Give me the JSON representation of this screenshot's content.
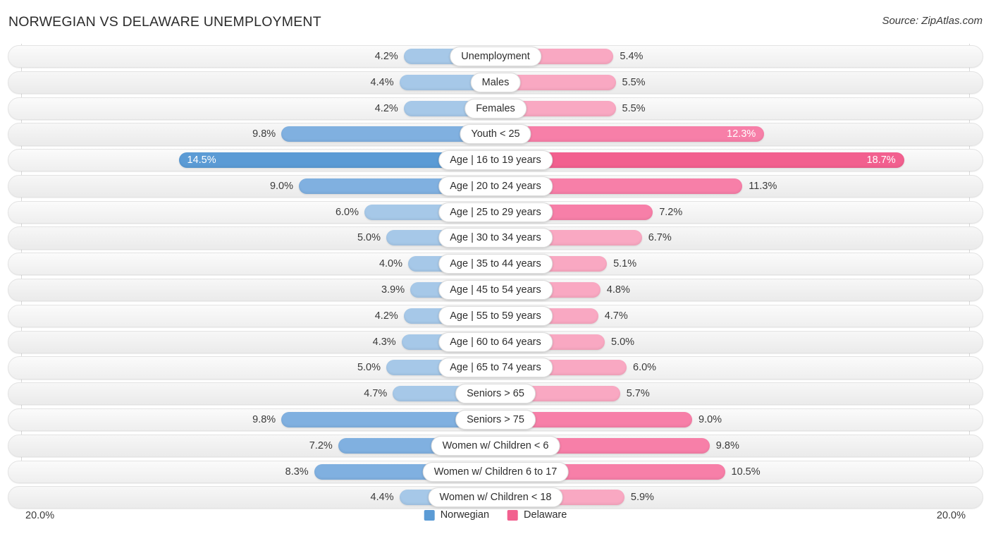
{
  "header": {
    "title": "NORWEGIAN VS DELAWARE UNEMPLOYMENT",
    "source": "Source: ZipAtlas.com"
  },
  "footer": {
    "axis_min_label": "20.0%",
    "axis_max_label": "20.0%",
    "legend": [
      {
        "name": "Norwegian",
        "color": "#5b9bd5"
      },
      {
        "name": "Delaware",
        "color": "#f2608f"
      }
    ]
  },
  "colors": {
    "left_light": "#a6c8e8",
    "left_mid": "#80b0e0",
    "left_dark": "#5b9bd5",
    "right_light": "#f9a8c2",
    "right_mid": "#f77fa8",
    "right_dark": "#f2608f",
    "track": "#f2f2f2",
    "gridline": "#d8d8d8"
  },
  "chart_data": {
    "type": "bar",
    "orientation": "horizontal-diverging",
    "title": "NORWEGIAN VS DELAWARE UNEMPLOYMENT",
    "xlabel": "",
    "ylabel": "",
    "axis_max": 20.0,
    "unit": "%",
    "grid": true,
    "legend_position": "bottom-center",
    "categories": [
      "Unemployment",
      "Males",
      "Females",
      "Youth < 25",
      "Age | 16 to 19 years",
      "Age | 20 to 24 years",
      "Age | 25 to 29 years",
      "Age | 30 to 34 years",
      "Age | 35 to 44 years",
      "Age | 45 to 54 years",
      "Age | 55 to 59 years",
      "Age | 60 to 64 years",
      "Age | 65 to 74 years",
      "Seniors > 65",
      "Seniors > 75",
      "Women w/ Children < 6",
      "Women w/ Children 6 to 17",
      "Women w/ Children < 18"
    ],
    "series": [
      {
        "name": "Norwegian",
        "values": [
          4.2,
          4.4,
          4.2,
          9.8,
          14.5,
          9.0,
          6.0,
          5.0,
          4.0,
          3.9,
          4.2,
          4.3,
          5.0,
          4.7,
          9.8,
          7.2,
          8.3,
          4.4
        ]
      },
      {
        "name": "Delaware",
        "values": [
          5.4,
          5.5,
          5.5,
          12.3,
          18.7,
          11.3,
          7.2,
          6.7,
          5.1,
          4.8,
          4.7,
          5.0,
          6.0,
          5.7,
          9.0,
          9.8,
          10.5,
          5.9
        ]
      }
    ]
  },
  "rows": [
    {
      "label": "Unemployment",
      "left_value": 4.2,
      "left_text": "4.2%",
      "right_value": 5.4,
      "right_text": "5.4%",
      "left_shade": "light",
      "right_shade": "light",
      "left_inside": false,
      "right_inside": false
    },
    {
      "label": "Males",
      "left_value": 4.4,
      "left_text": "4.4%",
      "right_value": 5.5,
      "right_text": "5.5%",
      "left_shade": "light",
      "right_shade": "light",
      "left_inside": false,
      "right_inside": false
    },
    {
      "label": "Females",
      "left_value": 4.2,
      "left_text": "4.2%",
      "right_value": 5.5,
      "right_text": "5.5%",
      "left_shade": "light",
      "right_shade": "light",
      "left_inside": false,
      "right_inside": false
    },
    {
      "label": "Youth < 25",
      "left_value": 9.8,
      "left_text": "9.8%",
      "right_value": 12.3,
      "right_text": "12.3%",
      "left_shade": "mid",
      "right_shade": "mid",
      "left_inside": false,
      "right_inside": true
    },
    {
      "label": "Age | 16 to 19 years",
      "left_value": 14.5,
      "left_text": "14.5%",
      "right_value": 18.7,
      "right_text": "18.7%",
      "left_shade": "dark",
      "right_shade": "dark",
      "left_inside": true,
      "right_inside": true
    },
    {
      "label": "Age | 20 to 24 years",
      "left_value": 9.0,
      "left_text": "9.0%",
      "right_value": 11.3,
      "right_text": "11.3%",
      "left_shade": "mid",
      "right_shade": "mid",
      "left_inside": false,
      "right_inside": false
    },
    {
      "label": "Age | 25 to 29 years",
      "left_value": 6.0,
      "left_text": "6.0%",
      "right_value": 7.2,
      "right_text": "7.2%",
      "left_shade": "light",
      "right_shade": "mid",
      "left_inside": false,
      "right_inside": false
    },
    {
      "label": "Age | 30 to 34 years",
      "left_value": 5.0,
      "left_text": "5.0%",
      "right_value": 6.7,
      "right_text": "6.7%",
      "left_shade": "light",
      "right_shade": "light",
      "left_inside": false,
      "right_inside": false
    },
    {
      "label": "Age | 35 to 44 years",
      "left_value": 4.0,
      "left_text": "4.0%",
      "right_value": 5.1,
      "right_text": "5.1%",
      "left_shade": "light",
      "right_shade": "light",
      "left_inside": false,
      "right_inside": false
    },
    {
      "label": "Age | 45 to 54 years",
      "left_value": 3.9,
      "left_text": "3.9%",
      "right_value": 4.8,
      "right_text": "4.8%",
      "left_shade": "light",
      "right_shade": "light",
      "left_inside": false,
      "right_inside": false
    },
    {
      "label": "Age | 55 to 59 years",
      "left_value": 4.2,
      "left_text": "4.2%",
      "right_value": 4.7,
      "right_text": "4.7%",
      "left_shade": "light",
      "right_shade": "light",
      "left_inside": false,
      "right_inside": false
    },
    {
      "label": "Age | 60 to 64 years",
      "left_value": 4.3,
      "left_text": "4.3%",
      "right_value": 5.0,
      "right_text": "5.0%",
      "left_shade": "light",
      "right_shade": "light",
      "left_inside": false,
      "right_inside": false
    },
    {
      "label": "Age | 65 to 74 years",
      "left_value": 5.0,
      "left_text": "5.0%",
      "right_value": 6.0,
      "right_text": "6.0%",
      "left_shade": "light",
      "right_shade": "light",
      "left_inside": false,
      "right_inside": false
    },
    {
      "label": "Seniors > 65",
      "left_value": 4.7,
      "left_text": "4.7%",
      "right_value": 5.7,
      "right_text": "5.7%",
      "left_shade": "light",
      "right_shade": "light",
      "left_inside": false,
      "right_inside": false
    },
    {
      "label": "Seniors > 75",
      "left_value": 9.8,
      "left_text": "9.8%",
      "right_value": 9.0,
      "right_text": "9.0%",
      "left_shade": "mid",
      "right_shade": "mid",
      "left_inside": false,
      "right_inside": false
    },
    {
      "label": "Women w/ Children < 6",
      "left_value": 7.2,
      "left_text": "7.2%",
      "right_value": 9.8,
      "right_text": "9.8%",
      "left_shade": "mid",
      "right_shade": "mid",
      "left_inside": false,
      "right_inside": false
    },
    {
      "label": "Women w/ Children 6 to 17",
      "left_value": 8.3,
      "left_text": "8.3%",
      "right_value": 10.5,
      "right_text": "10.5%",
      "left_shade": "mid",
      "right_shade": "mid",
      "left_inside": false,
      "right_inside": false
    },
    {
      "label": "Women w/ Children < 18",
      "left_value": 4.4,
      "left_text": "4.4%",
      "right_value": 5.9,
      "right_text": "5.9%",
      "left_shade": "light",
      "right_shade": "light",
      "left_inside": false,
      "right_inside": false
    }
  ]
}
